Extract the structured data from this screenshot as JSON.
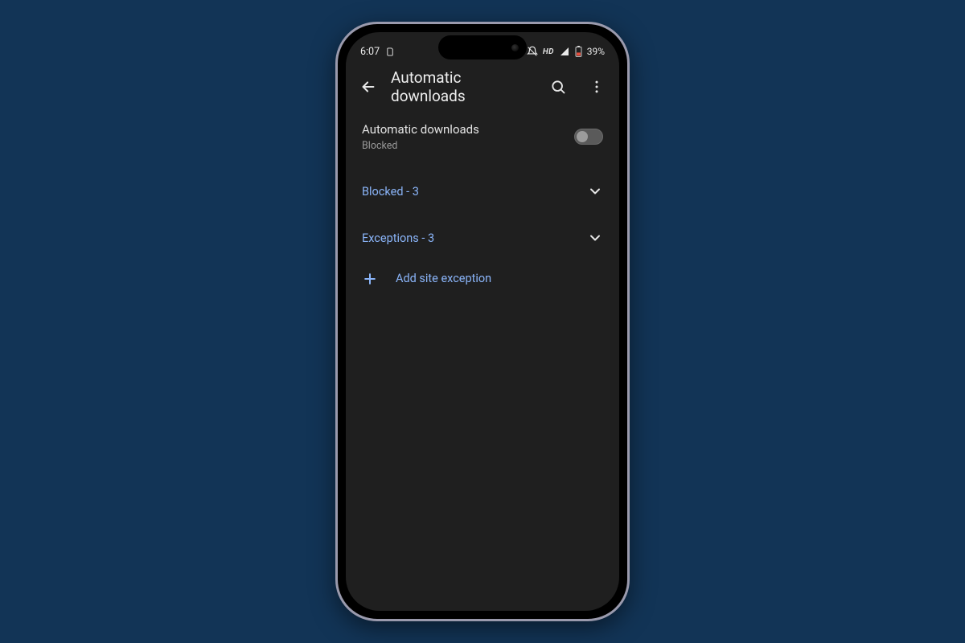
{
  "background_color": "#123456",
  "status_bar": {
    "time": "6:07",
    "battery_text": "39%",
    "hd_label": "HD"
  },
  "app_bar": {
    "title": "Automatic downloads"
  },
  "toggle_row": {
    "title": "Automatic downloads",
    "subtitle": "Blocked",
    "enabled": false
  },
  "sections": {
    "blocked_label": "Blocked - 3",
    "exceptions_label": "Exceptions - 3"
  },
  "add_exception": {
    "label": "Add site exception"
  }
}
